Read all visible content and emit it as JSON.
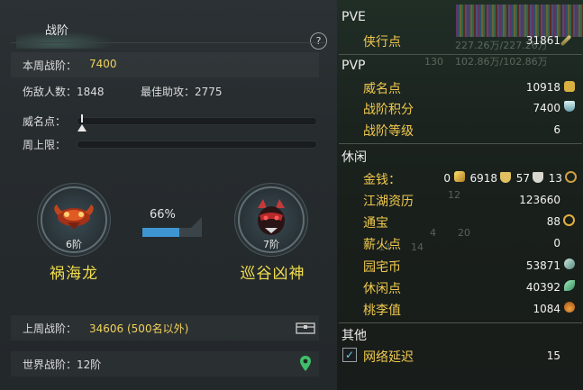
{
  "left_panel": {
    "title": "战阶",
    "help": "?",
    "weekly_rank_label": "本周战阶：",
    "weekly_rank_value": "7400",
    "injured_count": "伤敌人数：1848",
    "best_assist": "最佳助攻：2775",
    "prestige_label": "威名点：",
    "weekly_cap_label": "周上限：",
    "progress_percent_text": "66%",
    "progress_fraction": 0.66,
    "left_rank": {
      "level": "6阶",
      "name": "祸海龙"
    },
    "right_rank": {
      "level": "7阶",
      "name": "巡谷凶神"
    },
    "last_week_label": "上周战阶：",
    "last_week_value": "34606 (500名以外)",
    "world_rank": "世界战阶：12阶"
  },
  "right_panel": {
    "pve": {
      "category": "PVE",
      "rows": [
        {
          "key": "侠行点",
          "value": "31861",
          "icon": "sword-icon"
        }
      ]
    },
    "pvp": {
      "category": "PVP",
      "rows": [
        {
          "key": "威名点",
          "value": "10918",
          "icon": "mask-icon"
        },
        {
          "key": "战阶积分",
          "value": "7400",
          "icon": "crystal-icon"
        },
        {
          "key": "战阶等级",
          "value": "6"
        }
      ]
    },
    "leisure": {
      "category": "休闲",
      "money_key": "金钱：",
      "money_values": [
        "0",
        "6918",
        "57",
        "13"
      ],
      "rows": [
        {
          "key": "江湖资历",
          "value": "123660"
        },
        {
          "key": "通宝",
          "value": "88",
          "icon": "coin-icon"
        },
        {
          "key": "薪火点",
          "value": "0"
        },
        {
          "key": "园宅币",
          "value": "53871",
          "icon": "house-coin-icon"
        },
        {
          "key": "休闲点",
          "value": "40392",
          "icon": "leaf-icon"
        },
        {
          "key": "桃李值",
          "value": "1084",
          "icon": "gourd-icon"
        }
      ]
    },
    "other": {
      "category": "其他",
      "network_label": "网络延迟",
      "network_value": "15",
      "network_checked": true
    },
    "background_text": [
      "227.26万/227.26万",
      "102.86万/102.86万",
      "130",
      "12",
      "14",
      "14",
      "4",
      "20"
    ]
  },
  "colors": {
    "gold": "#f0c94e",
    "yellow": "#f0d25a",
    "progress_blue": "#3f95d2"
  }
}
